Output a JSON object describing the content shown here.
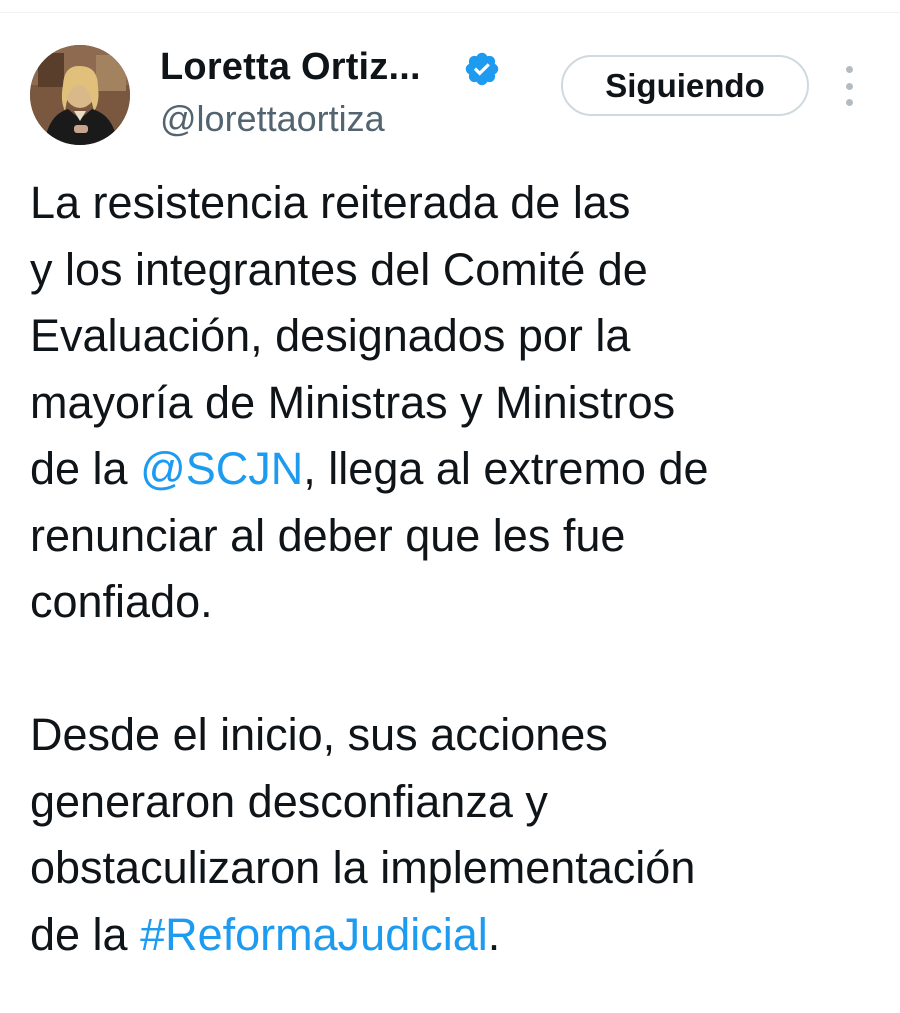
{
  "author": {
    "display_name": "Loretta Ortiz...",
    "handle": "@lorettaortiza",
    "verified_icon": "verified-badge-icon",
    "avatar_alt": "profile photo"
  },
  "actions": {
    "follow_label": "Siguiendo",
    "more_icon": "more-vertical-icon"
  },
  "tweet": {
    "lines": [
      "La resistencia reiterada de las",
      "y los integrantes del Comité de",
      "Evaluación, designados por la",
      "mayoría de Ministras y Ministros",
      "de la ",
      "@SCJN",
      ", llega al extremo de",
      "renunciar al deber que les fue",
      "confiado.",
      "Desde el inicio, sus acciones",
      "generaron desconfianza y",
      "obstaculizaron la implementación",
      "de la ",
      "#ReformaJudicial",
      "."
    ]
  },
  "colors": {
    "text": "#0f1419",
    "secondary": "#536471",
    "link": "#1d9bf0",
    "verified": "#1d9bf0",
    "button_border": "#cfd9de"
  }
}
